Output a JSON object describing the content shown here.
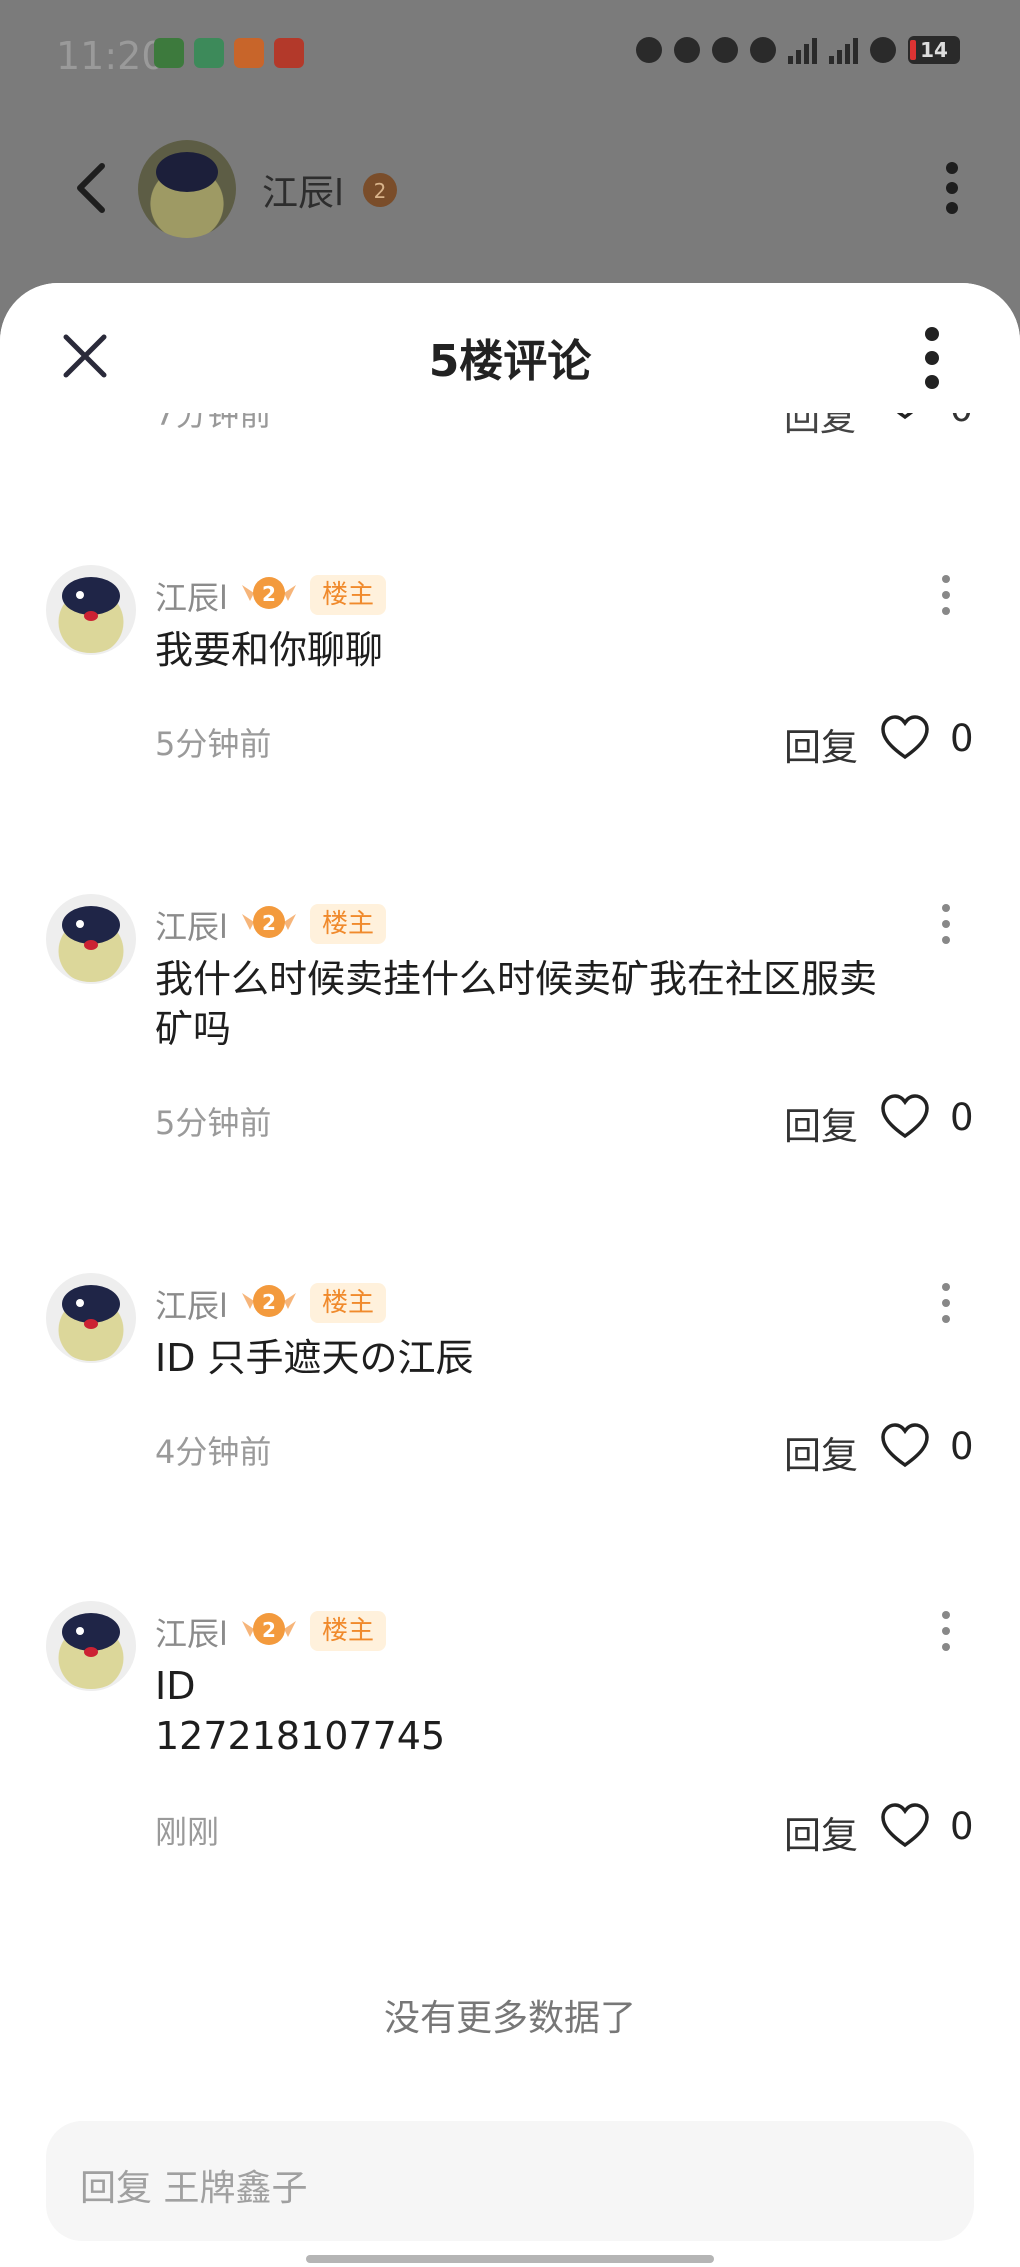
{
  "status_bar": {
    "time": "11:20",
    "battery": "14"
  },
  "background_header": {
    "name": "江辰l",
    "level": "2"
  },
  "sheet": {
    "title": "5楼评论",
    "partial_row": {
      "time": "7分钟前",
      "reply": "回复",
      "likes": "0"
    },
    "comments": [
      {
        "username": "江辰l",
        "level": "2",
        "tag": "楼主",
        "content": "我要和你聊聊",
        "time": "5分钟前",
        "reply": "回复",
        "likes": "0"
      },
      {
        "username": "江辰l",
        "level": "2",
        "tag": "楼主",
        "content": "我什么时候卖挂什么时候卖矿我在社区服卖\n矿吗",
        "time": "5分钟前",
        "reply": "回复",
        "likes": "0"
      },
      {
        "username": "江辰l",
        "level": "2",
        "tag": "楼主",
        "content": "ID   只手遮天の江辰",
        "time": "4分钟前",
        "reply": "回复",
        "likes": "0"
      },
      {
        "username": "江辰l",
        "level": "2",
        "tag": "楼主",
        "content": "ID\n127218107745",
        "time": "刚刚",
        "reply": "回复",
        "likes": "0"
      }
    ],
    "no_more": "没有更多数据了",
    "reply_placeholder": "回复 王牌鑫子"
  },
  "colors": {
    "accent_tag_bg": "#fff1dc",
    "accent_tag_text": "#f08a2c",
    "badge_orange": "#f39a3d"
  }
}
